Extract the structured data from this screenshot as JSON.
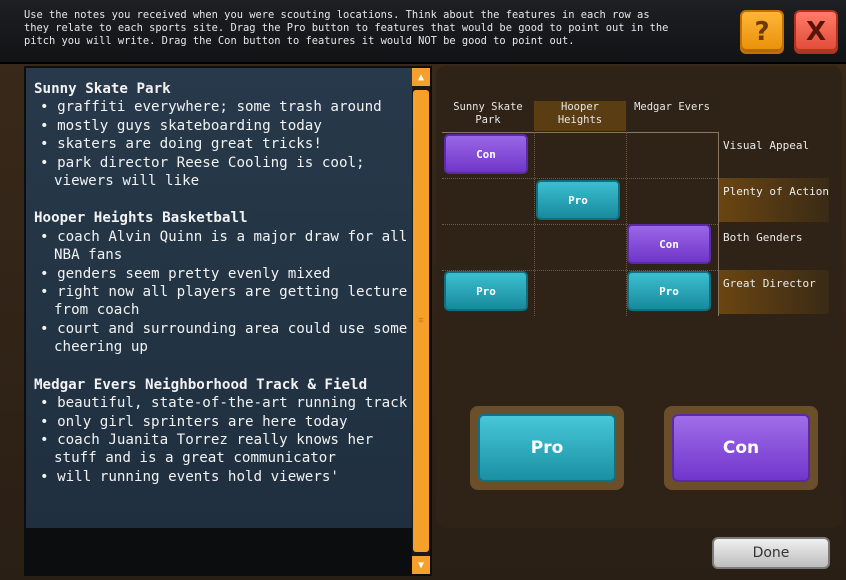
{
  "header": {
    "instructions": "Use the notes you received when you were scouting locations. Think about the features in each row as\nthey relate to each sports site. Drag the Pro button to features that would be good to point out in the\npitch you will write. Drag the Con button to features it would NOT be good to point out.",
    "help_label": "?",
    "close_label": "X"
  },
  "notes": {
    "sites": [
      {
        "title": "Sunny Skate Park",
        "bullets": [
          "• graffiti everywhere; some trash around",
          "• mostly guys skateboarding today",
          "• skaters are doing great tricks!",
          "• park director Reese Cooling is cool; viewers will like"
        ]
      },
      {
        "title": "Hooper Heights Basketball",
        "bullets": [
          "• coach Alvin Quinn is a major draw for all NBA fans",
          "• genders seem pretty evenly mixed",
          "• right now all players are getting lecture from coach",
          "• court and surrounding area could use some cheering up"
        ]
      },
      {
        "title": "Medgar Evers Neighborhood Track & Field",
        "bullets": [
          "• beautiful, state-of-the-art running track",
          "• only girl sprinters are here today",
          "• coach Juanita Torrez really knows her stuff and is a great communicator",
          "• will running events hold viewers'"
        ]
      }
    ],
    "scroll_up_icon": "▲",
    "scroll_down_icon": "▼",
    "scroll_grip_icon": "≡"
  },
  "grid": {
    "columns": [
      "Sunny Skate\nPark",
      "Hooper\nHeights",
      "Medgar Evers"
    ],
    "rows": [
      "Visual Appeal",
      "Plenty of Action",
      "Both Genders",
      "Great Director"
    ],
    "chips": {
      "r0c0": "Con",
      "r1c1": "Pro",
      "r2c2": "Con",
      "r3c0": "Pro",
      "r3c2": "Pro"
    }
  },
  "drag": {
    "pro_label": "Pro",
    "con_label": "Con"
  },
  "footer": {
    "done_label": "Done"
  },
  "colors": {
    "pro": "#2aa9bb",
    "con": "#8a55de",
    "accent": "#f6a02c"
  }
}
